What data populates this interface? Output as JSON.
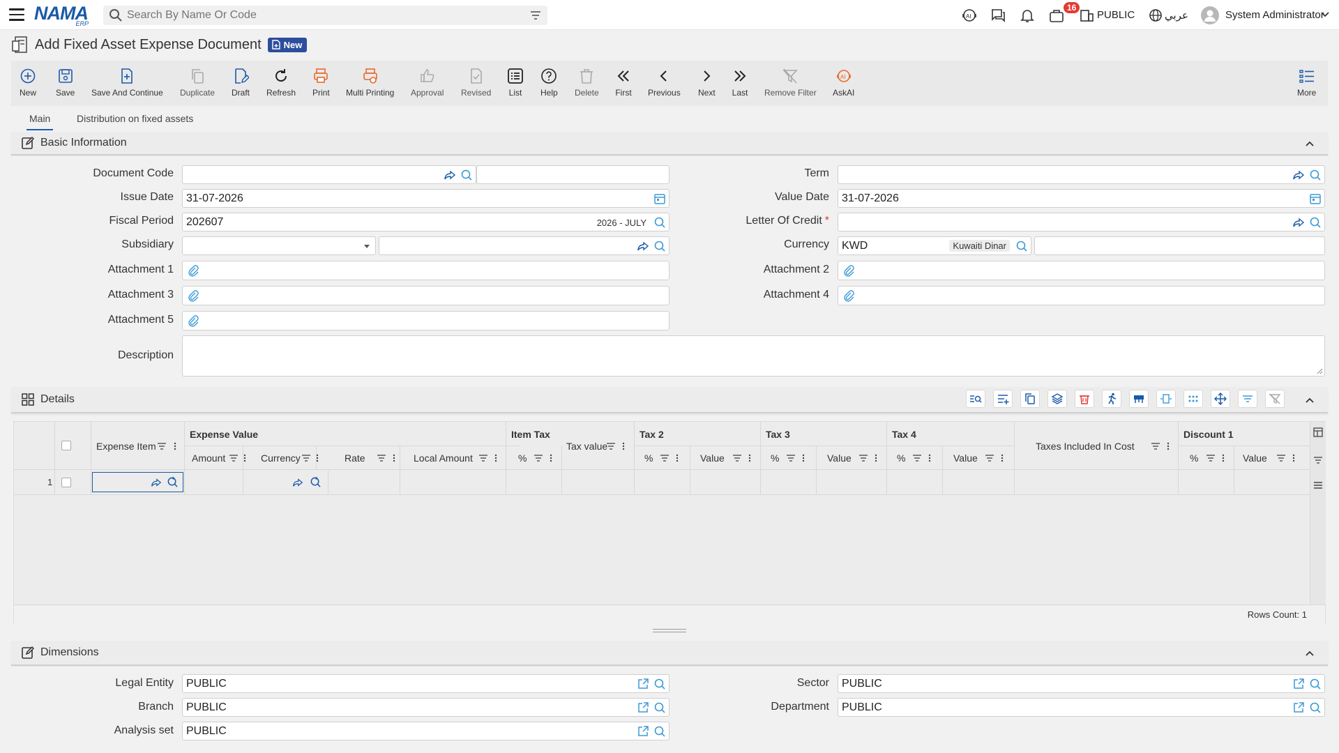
{
  "header": {
    "logo_main": "NAMA",
    "logo_sub": "ERP",
    "search_placeholder": "Search By Name Or Code",
    "notifications_count": "16",
    "company": "PUBLIC",
    "language": "عربي",
    "user": "System Administrator"
  },
  "page": {
    "title": "Add Fixed Asset Expense Document",
    "badge": "New"
  },
  "toolbar": {
    "new": "New",
    "save": "Save",
    "save_continue": "Save And Continue",
    "duplicate": "Duplicate",
    "draft": "Draft",
    "refresh": "Refresh",
    "print": "Print",
    "multi_printing": "Multi Printing",
    "approval": "Approval",
    "revised": "Revised",
    "list": "List",
    "help": "Help",
    "delete": "Delete",
    "first": "First",
    "previous": "Previous",
    "next": "Next",
    "last": "Last",
    "remove_filter": "Remove Filter",
    "askai": "AskAI",
    "more": "More"
  },
  "tabs": [
    "Main",
    "Distribution on fixed assets"
  ],
  "basic": {
    "title": "Basic Information",
    "document_code_label": "Document Code",
    "issue_date_label": "Issue Date",
    "issue_date": "31-07-2026",
    "fiscal_period_label": "Fiscal Period",
    "fiscal_period": "202607",
    "fiscal_period_name": "2026 - JULY",
    "subsidiary_label": "Subsidiary",
    "attachment1_label": "Attachment 1",
    "attachment3_label": "Attachment 3",
    "attachment5_label": "Attachment 5",
    "description_label": "Description",
    "term_label": "Term",
    "value_date_label": "Value Date",
    "value_date": "31-07-2026",
    "letter_of_credit_label": "Letter Of Credit",
    "currency_label": "Currency",
    "currency_code": "KWD",
    "currency_name": "Kuwaiti Dinar",
    "attachment2_label": "Attachment 2",
    "attachment4_label": "Attachment 4"
  },
  "details": {
    "title": "Details",
    "group_expense_value": "Expense Value",
    "group_item_tax": "Item Tax",
    "group_tax2": "Tax 2",
    "group_tax3": "Tax 3",
    "group_tax4": "Tax 4",
    "group_discount1": "Discount 1",
    "col_expense_item": "Expense Item",
    "col_amount": "Amount",
    "col_currency": "Currency",
    "col_rate": "Rate",
    "col_local_amount": "Local Amount",
    "col_pct": "%",
    "col_tax_value": "Tax value",
    "col_value": "Value",
    "col_taxes_included": "Taxes Included In Cost",
    "row_number": "1",
    "rows_count": "Rows Count: 1"
  },
  "dimensions": {
    "title": "Dimensions",
    "legal_entity_label": "Legal Entity",
    "legal_entity": "PUBLIC",
    "branch_label": "Branch",
    "branch": "PUBLIC",
    "analysis_set_label": "Analysis set",
    "analysis_set": "PUBLIC",
    "sector_label": "Sector",
    "sector": "PUBLIC",
    "department_label": "Department",
    "department": "PUBLIC"
  },
  "colors": {
    "brand": "#1a5aa8",
    "accent_orange": "#e8692a",
    "danger": "#e53935",
    "badge_bg": "#2d4e9e"
  }
}
